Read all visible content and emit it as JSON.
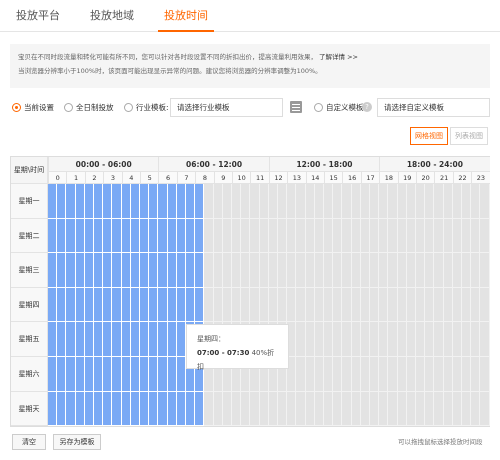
{
  "tabs": [
    {
      "label": "投放平台"
    },
    {
      "label": "投放地域"
    },
    {
      "label": "投放时间"
    }
  ],
  "notice": {
    "line1": "宝贝在不同时段流量和转化可能有所不同，您可以针对各时段设置不同的折扣出价，提高流量利用效果，",
    "link": "了解详情 >>",
    "line2": "当浏览器分辨率小于100%时，该页面可能出现显示异常的问题。建议您将浏览器的分辨率调整为100%。"
  },
  "options": {
    "current": "当前设置",
    "all_day": "全日制投放",
    "industry": "行业模板:",
    "industry_placeholder": "请选择行业模板",
    "custom": "自定义模板:",
    "custom_placeholder": "请选择自定义模板",
    "help": "?"
  },
  "view": {
    "grid": "网格视图",
    "list": "列表视图"
  },
  "grid": {
    "corner": "星期\\时间",
    "groups": [
      "00:00 - 06:00",
      "06:00 - 12:00",
      "12:00 - 18:00",
      "18:00 - 24:00"
    ],
    "hours": [
      "0",
      "1",
      "2",
      "3",
      "4",
      "5",
      "6",
      "7",
      "8",
      "9",
      "10",
      "11",
      "12",
      "13",
      "14",
      "15",
      "16",
      "17",
      "18",
      "19",
      "20",
      "21",
      "22",
      "23"
    ],
    "days": [
      "星期一",
      "星期二",
      "星期三",
      "星期四",
      "星期五",
      "星期六",
      "星期天"
    ],
    "schedule": {
      "active_start_hour": 0,
      "active_end_hour": 8.5,
      "rows": 7
    },
    "colors": {
      "active": "#7aa9f5",
      "active_line": "#ffffff",
      "inactive": "#e3e3e3",
      "inactive_line": "#f2f2f2"
    }
  },
  "tooltip": {
    "day": "星期四：",
    "time": "07:00 - 07:30",
    "discount": "40%折扣"
  },
  "bottom": {
    "clear": "清空",
    "save_template": "另存为模板",
    "hint": "可以拖拽鼠标选择投放时间段"
  },
  "colors": {
    "accent": "#ff6600"
  }
}
